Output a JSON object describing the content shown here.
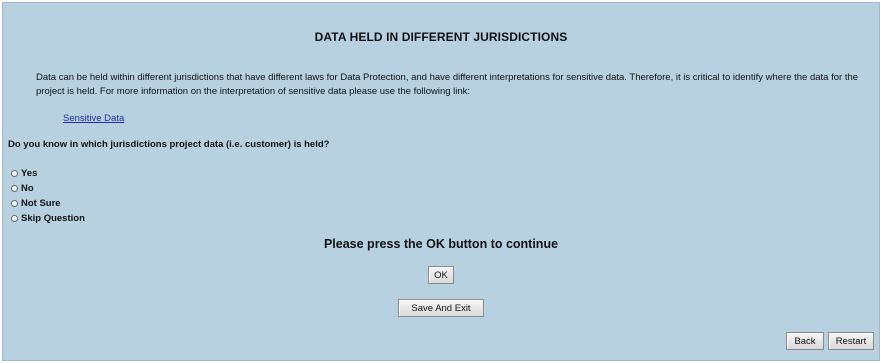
{
  "page": {
    "title": "DATA HELD IN DIFFERENT JURISDICTIONS",
    "intro_text": "Data can be held within different jurisdictions that have different laws for Data Protection, and have different interpretations for sensitive data. Therefore, it is critical to identify where the data for the project is held. For more information on the interpretation of sensitive data please use the following link:",
    "link_label": "Sensitive Data"
  },
  "question": {
    "text": "Do you know in which jurisdictions project data (i.e. customer) is held?",
    "options": [
      {
        "label": "Yes",
        "selected": false
      },
      {
        "label": "No",
        "selected": false
      },
      {
        "label": "Not Sure",
        "selected": false
      },
      {
        "label": "Skip Question",
        "selected": false
      }
    ]
  },
  "instructions": {
    "press_ok": "Please press the OK button to continue"
  },
  "buttons": {
    "ok": "OK",
    "save_exit": "Save And Exit",
    "back": "Back",
    "restart": "Restart"
  },
  "colors": {
    "panel_background": "#b7d1e0",
    "link": "#1f2fa8"
  }
}
